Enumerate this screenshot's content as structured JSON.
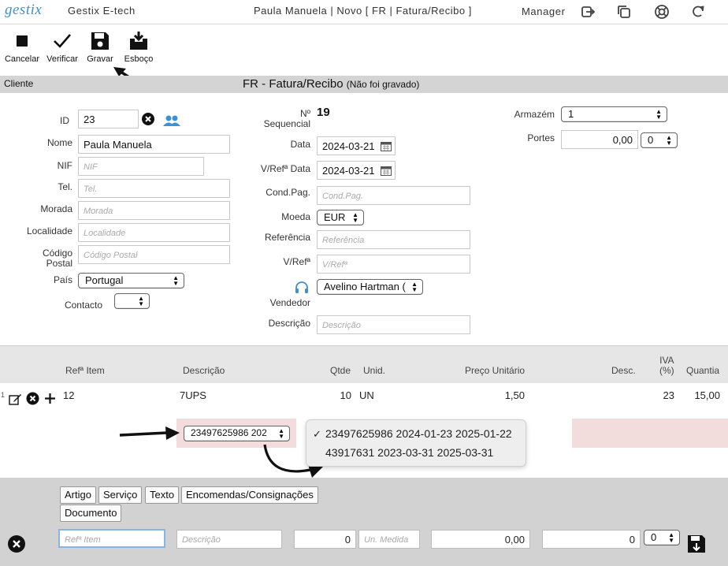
{
  "header": {
    "logo": "gestix",
    "company": "Gestix E-tech",
    "doc_title": "Paula Manuela | Novo [ FR | Fatura/Recibo ]",
    "user": "Manager"
  },
  "toolbar": {
    "cancel": "Cancelar",
    "verify": "Verificar",
    "save": "Gravar",
    "draft": "Esboço"
  },
  "section": {
    "label": "Cliente",
    "title": "FR - Fatura/Recibo",
    "title_note": "(Não foi gravado)"
  },
  "client": {
    "id_label": "ID",
    "id_value": "23",
    "name_label": "Nome",
    "name_value": "Paula Manuela",
    "nif_label": "NIF",
    "nif_placeholder": "NIF",
    "tel_label": "Tel.",
    "tel_placeholder": "Tel.",
    "morada_label": "Morada",
    "morada_placeholder": "Morada",
    "localidade_label": "Localidade",
    "localidade_placeholder": "Localidade",
    "cp_label_1": "Código",
    "cp_label_2": "Postal",
    "cp_placeholder": "Código Postal",
    "pais_label": "País",
    "pais_value": "Portugal",
    "contacto_label": "Contacto",
    "contacto_value": ""
  },
  "doc": {
    "seq_label_1": "Nº",
    "seq_label_2": "Sequencial",
    "seq_value": "19",
    "data_label": "Data",
    "data_value": "2024-03-21",
    "vref_data_label": "V/Refª Data",
    "vref_data_value": "2024-03-21",
    "condpag_label": "Cond.Pag.",
    "condpag_placeholder": "Cond.Pag.",
    "moeda_label": "Moeda",
    "moeda_value": "EUR",
    "referencia_label": "Referência",
    "referencia_placeholder": "Referência",
    "vref_label": "V/Refª",
    "vref_placeholder": "V/Refª",
    "vendedor_label": "Vendedor",
    "vendedor_value": "Avelino Hartman (",
    "descricao_label": "Descrição",
    "descricao_placeholder": "Descrição"
  },
  "right": {
    "armazem_label": "Armazém",
    "armazem_value": "1",
    "portes_label": "Portes",
    "portes_value": "0,00",
    "portes_tax": "0"
  },
  "lines": {
    "columns": {
      "ref": "Refª Item",
      "desc": "Descrição",
      "qtde": "Qtde",
      "unid": "Unid.",
      "preco": "Preço Unitário",
      "descp": "Desc.",
      "iva_1": "IVA",
      "iva_2": "(%)",
      "quantia": "Quantia"
    },
    "rows": [
      {
        "num": "1",
        "ref": "12",
        "desc": "7UPS",
        "qtde": "10",
        "unid": "UN",
        "preco": "1,50",
        "desc_pct": "",
        "iva": "23",
        "quantia": "15,00"
      }
    ],
    "serial_select": "23497625986 202",
    "serial_options": [
      {
        "label": "23497625986 2024-01-23 2025-01-22",
        "checked": true,
        "check": "✓"
      },
      {
        "label": "43917631 2023-03-31 2025-03-31",
        "checked": false,
        "check": ""
      }
    ]
  },
  "bottom": {
    "tabs": [
      "Artigo",
      "Serviço",
      "Texto",
      "Encomendas/Consignações",
      "Documento"
    ],
    "ref_placeholder": "Refª Item",
    "desc_placeholder": "Descrição",
    "qty_value": "0",
    "unit_placeholder": "Un. Medida",
    "price_value": "0,00",
    "disc_value": "0",
    "tax_value": "0"
  },
  "colors": {
    "accent": "#3d8fd6",
    "section_bar": "#d4d4d4",
    "highlight_row": "#f3dcdc"
  }
}
